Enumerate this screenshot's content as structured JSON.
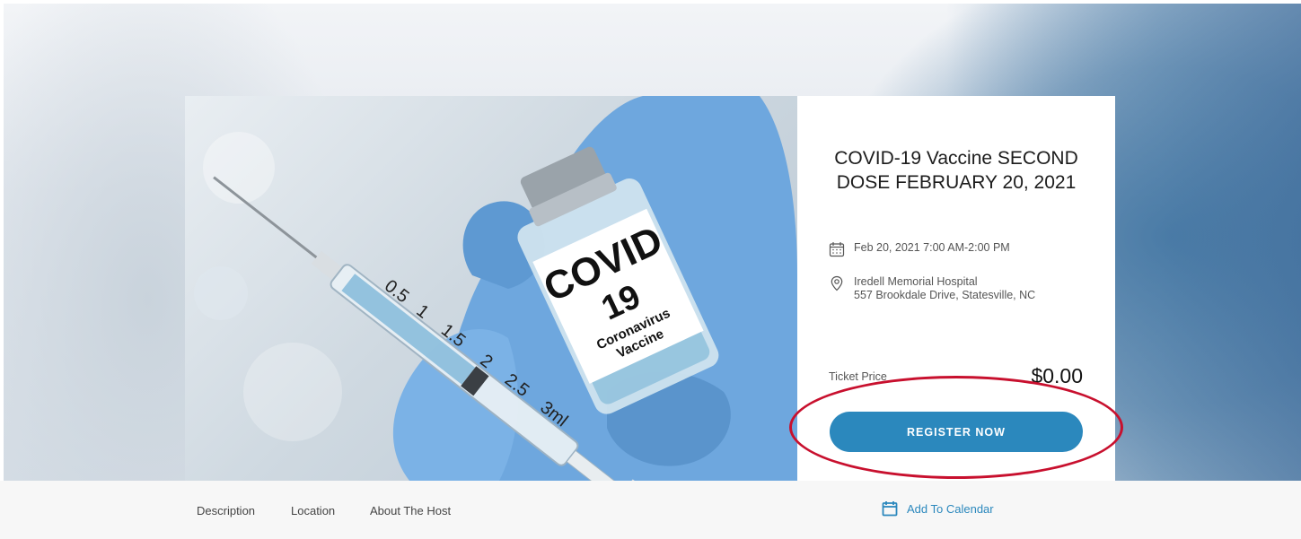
{
  "event": {
    "title": "COVID-19 Vaccine SECOND DOSE FEBRUARY 20, 2021",
    "datetime": "Feb 20, 2021 7:00 AM-2:00 PM",
    "location_name": "Iredell Memorial Hospital",
    "location_address": "557 Brookdale Drive, Statesville, NC",
    "price_label": "Ticket Price",
    "price": "$0.00",
    "register_label": "REGISTER NOW"
  },
  "image": {
    "label_line1": "COVID",
    "label_line2": "19",
    "label_line3": "Coronavirus",
    "label_line4": "Vaccine",
    "syringe_marks": [
      "0.5",
      "1",
      "1.5",
      "2",
      "2.5",
      "3ml"
    ]
  },
  "subnav": {
    "description": "Description",
    "location": "Location",
    "about_host": "About The Host",
    "add_to_calendar": "Add To Calendar"
  },
  "icons": {
    "date": "calendar-icon",
    "location": "map-pin-icon",
    "add_calendar": "calendar-icon"
  },
  "colors": {
    "accent": "#2b88bd",
    "highlight": "#c8102e",
    "glove": "#6ea7de"
  }
}
